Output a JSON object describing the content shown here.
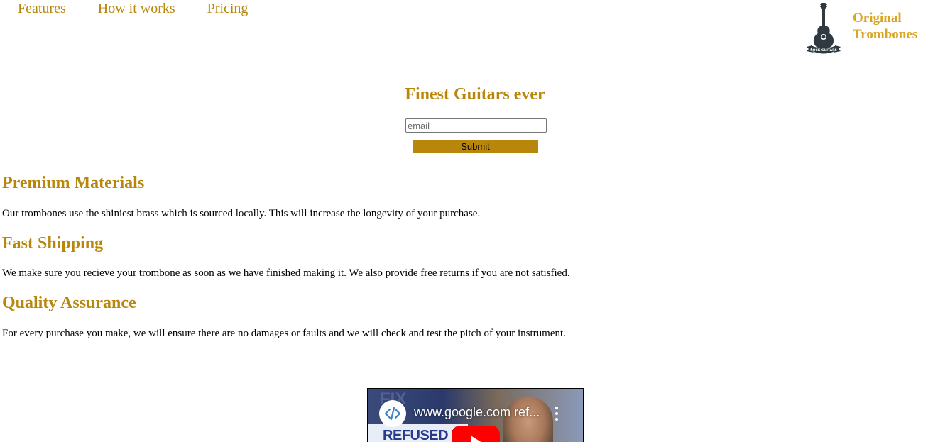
{
  "nav": {
    "items": [
      {
        "label": "Features"
      },
      {
        "label": "How it works"
      },
      {
        "label": "Pricing"
      }
    ]
  },
  "brand": {
    "line1": "Original",
    "line2": "Trombones",
    "logo_icon": "guitar-badge-icon",
    "logo_ribbon_text": "ROCK GUITARS"
  },
  "hero": {
    "title": "Finest Guitars ever",
    "email_placeholder": "email",
    "submit_label": "Submit"
  },
  "features": [
    {
      "title": "Premium Materials",
      "text": "Our trombones use the shiniest brass which is sourced locally. This will increase the longevity of your purchase."
    },
    {
      "title": "Fast Shipping",
      "text": "We make sure you recieve your trombone as soon as we have finished making it. We also provide free returns if you are not satisfied."
    },
    {
      "title": "Quality Assurance",
      "text": "For every purchase you make, we will ensure there are no damages or faults and we will check and test the pitch of your instrument."
    }
  ],
  "video": {
    "title": "www.google.com ref...",
    "thumb_text_top": "FIX",
    "thumb_text_main": "REFUSED TO",
    "channel_icon": "code-brackets-icon",
    "menu_icon": "kebab-menu-icon",
    "play_icon": "youtube-play-icon"
  },
  "colors": {
    "accent": "#b8860b",
    "brand": "#daa520"
  }
}
